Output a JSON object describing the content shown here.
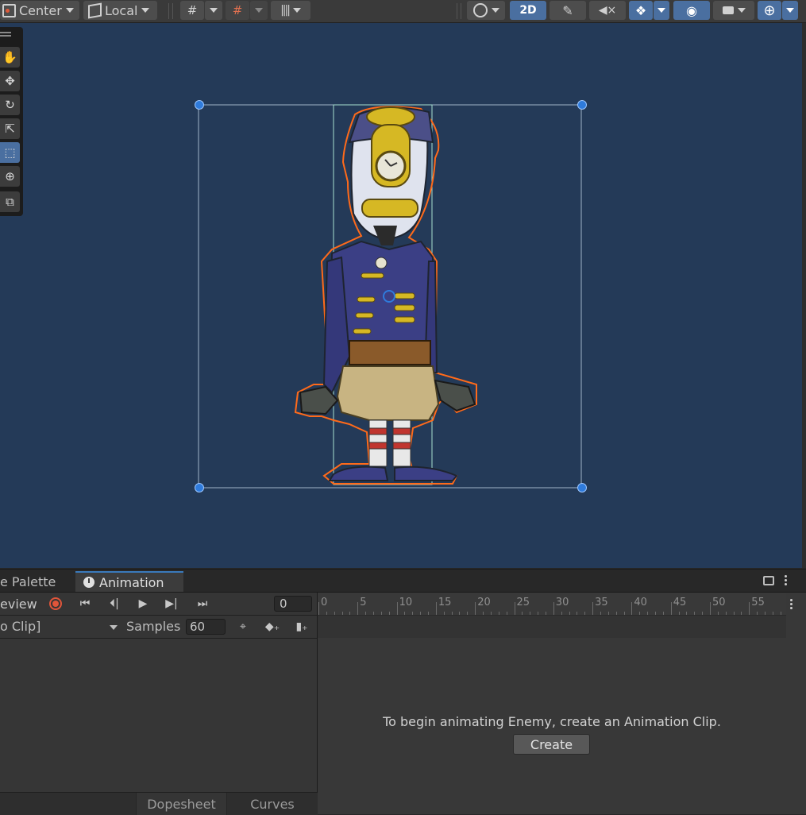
{
  "toolbar": {
    "pivot_label": "Center",
    "space_label": "Local",
    "mode_2d_label": "2D"
  },
  "tools": [
    "hand-tool",
    "move-tool",
    "rotate-tool",
    "scale-tool",
    "rect-tool",
    "transform-tool",
    "custom-tool"
  ],
  "tabs": {
    "palette_label": "e Palette",
    "animation_label": "Animation"
  },
  "animation": {
    "preview_label": "eview",
    "frame_value": "0",
    "clip_label": "o Clip]",
    "samples_label": "Samples",
    "samples_value": "60",
    "ruler_ticks": [
      "0",
      "5",
      "10",
      "15",
      "20",
      "25",
      "30",
      "35",
      "40",
      "45",
      "50",
      "55"
    ],
    "empty_message": "To begin animating Enemy, create an Animation Clip.",
    "create_label": "Create",
    "dopesheet_label": "Dopesheet",
    "curves_label": "Curves"
  },
  "colors": {
    "scene_bg": "#243a58",
    "selection_outline": "#ff6a1a",
    "handle": "#2f7bdc",
    "accent": "#4a6fa0",
    "record": "#e0553a"
  }
}
